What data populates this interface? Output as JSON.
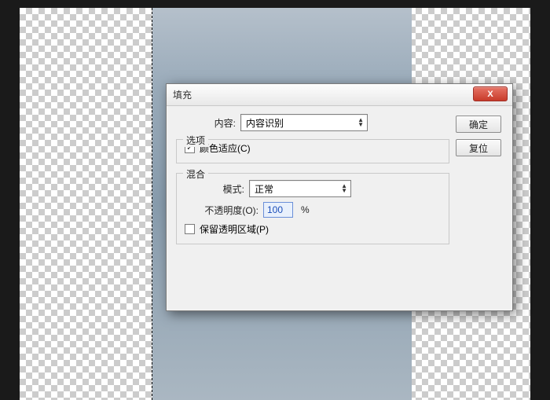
{
  "dialog": {
    "title": "填充",
    "close_icon": "X",
    "content_label": "内容:",
    "content_value": "内容识别",
    "ok_label": "确定",
    "reset_label": "复位",
    "options": {
      "legend": "选项",
      "color_adapt_label": "颜色适应(C)",
      "color_adapt_checked": true
    },
    "blend": {
      "legend": "混合",
      "mode_label": "模式:",
      "mode_value": "正常",
      "opacity_label": "不透明度(O):",
      "opacity_value": "100",
      "opacity_unit": "%",
      "preserve_label": "保留透明区域(P)",
      "preserve_checked": false
    }
  }
}
